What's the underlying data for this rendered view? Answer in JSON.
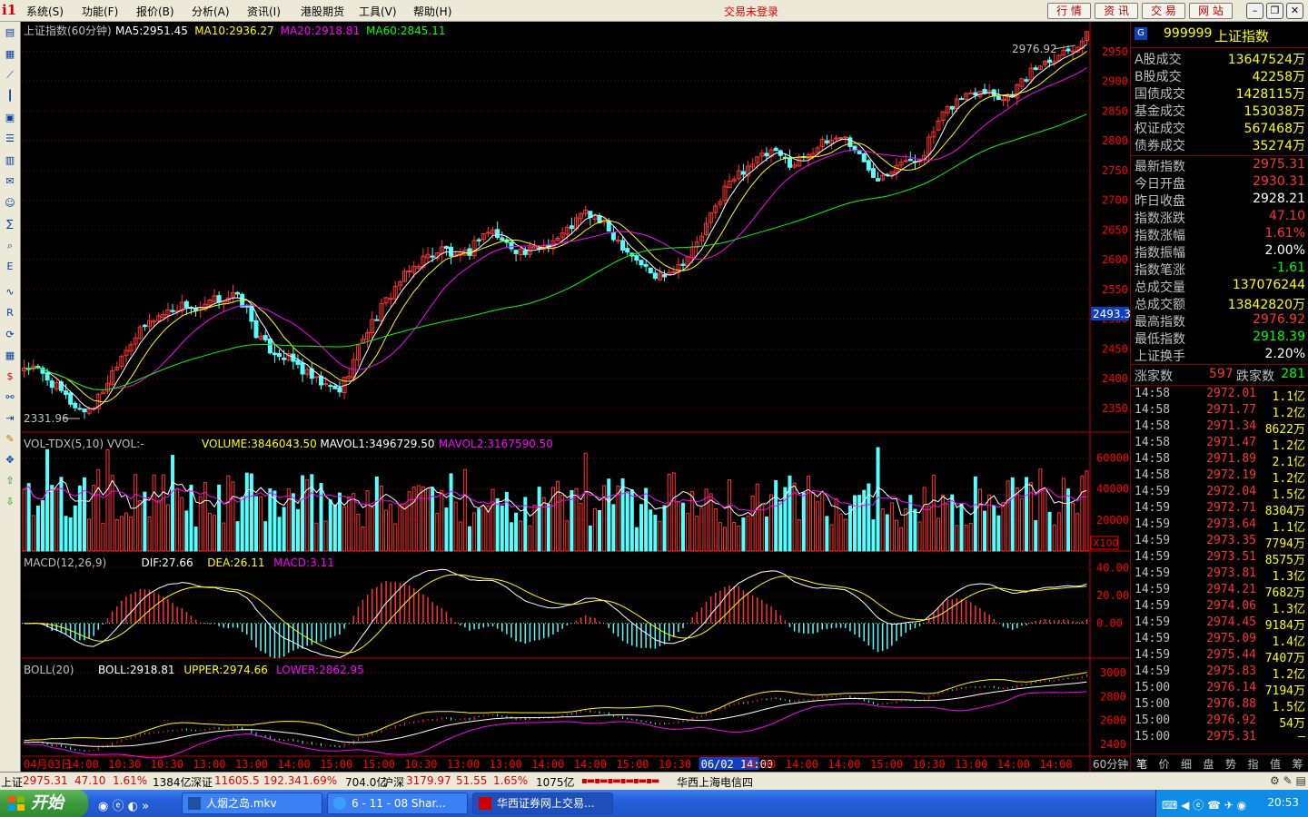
{
  "menu": {
    "items": [
      "系统(S)",
      "功能(F)",
      "报价(B)",
      "分析(A)",
      "资讯(I)",
      "港股期货",
      "工具(V)",
      "帮助(H)"
    ],
    "login_status": "交易未登录",
    "top_buttons": [
      "行 情",
      "资 讯",
      "交 易",
      "网 站"
    ]
  },
  "colors": {
    "up": "#ff3232",
    "down": "#54ffff",
    "ma5": "#ffffff",
    "ma10": "#ffff00",
    "ma20": "#ff00ff",
    "ma60": "#00ff00",
    "axis": "#ff0000",
    "grid": "#800000",
    "text_red": "#ff3232",
    "text_green": "#00ff00",
    "text_yellow": "#ffff00"
  },
  "chart_data": {
    "type": "candlestick",
    "panes": [
      {
        "name": "main",
        "title": "上证指数(60分钟)",
        "indicators": [
          {
            "label": "MA5:2951.45",
            "color": "#ffffff"
          },
          {
            "label": "MA10:2936.27",
            "color": "#ffff00"
          },
          {
            "label": "MA20:2918.81",
            "color": "#ff00ff"
          },
          {
            "label": "MA60:2845.11",
            "color": "#00ff00"
          }
        ],
        "ylim": [
          2310,
          3000
        ],
        "ticks": [
          2350,
          2400,
          2450,
          2500,
          2550,
          2600,
          2650,
          2700,
          2750,
          2800,
          2850,
          2900,
          2950
        ],
        "high_label": "2976.92",
        "low_label": "2331.96",
        "cursor_price": "2493.3",
        "close_path": [
          2420,
          2415,
          2400,
          2380,
          2360,
          2345,
          2355,
          2390,
          2430,
          2460,
          2480,
          2500,
          2510,
          2520,
          2525,
          2510,
          2530,
          2535,
          2540,
          2520,
          2470,
          2450,
          2440,
          2430,
          2410,
          2395,
          2385,
          2380,
          2420,
          2470,
          2500,
          2530,
          2560,
          2580,
          2600,
          2610,
          2620,
          2600,
          2610,
          2640,
          2650,
          2630,
          2620,
          2610,
          2620,
          2630,
          2640,
          2660,
          2680,
          2670,
          2650,
          2630,
          2610,
          2590,
          2570,
          2580,
          2590,
          2610,
          2640,
          2680,
          2720,
          2740,
          2760,
          2770,
          2780,
          2770,
          2760,
          2780,
          2790,
          2800,
          2810,
          2790,
          2760,
          2740,
          2750,
          2770,
          2760,
          2780,
          2820,
          2850,
          2870,
          2880,
          2890,
          2880,
          2870,
          2890,
          2910,
          2930,
          2940,
          2950,
          2960,
          2975
        ]
      },
      {
        "name": "volume",
        "title": "VOL-TDX(5,10) VVOL:-",
        "indicators": [
          {
            "label": "VOLUME:3846043.50",
            "color": "#ffff00"
          },
          {
            "label": "MAVOL1:3496729.50",
            "color": "#ffffff"
          },
          {
            "label": "MAVOL2:3167590.50",
            "color": "#ff00ff"
          }
        ],
        "ylim": [
          0,
          75000
        ],
        "ticks": [
          20000,
          40000,
          60000
        ],
        "unit_label": "X100"
      },
      {
        "name": "macd",
        "title": "MACD(12,26,9)",
        "indicators": [
          {
            "label": "DIF:27.66",
            "color": "#ffffff"
          },
          {
            "label": "DEA:26.11",
            "color": "#ffff00"
          },
          {
            "label": "MACD:3.11",
            "color": "#ff00ff"
          }
        ],
        "ylim": [
          -25,
          50
        ],
        "ticks": [
          0.0,
          20.0,
          40.0
        ]
      },
      {
        "name": "boll",
        "title": "BOLL(20)",
        "indicators": [
          {
            "label": "BOLL:2918.81",
            "color": "#ffffff"
          },
          {
            "label": "UPPER:2974.66",
            "color": "#ffff00"
          },
          {
            "label": "LOWER:2862.95",
            "color": "#ff00ff"
          }
        ],
        "ylim": [
          2300,
          3100
        ],
        "ticks": [
          2400,
          2600,
          2800,
          3000
        ]
      }
    ],
    "x_labels": [
      "04月03日",
      "14:00",
      "10:30",
      "10:30",
      "13:00",
      "13:00",
      "14:00",
      "15:00",
      "15:00",
      "10:30",
      "13:00",
      "13:00",
      "14:00",
      "14:00",
      "15:00",
      "10:30",
      "06/02 14:00",
      "13:00",
      "14:00",
      "14:00",
      "15:00",
      "10:30",
      "13:00",
      "14:00",
      "14:00"
    ],
    "period_label": "60分钟"
  },
  "quote": {
    "badge": "G",
    "code": "999999",
    "name": "上证指数",
    "rows_vol": [
      {
        "label": "A股成交",
        "value": "13647524万",
        "color": "#ffff00"
      },
      {
        "label": "B股成交",
        "value": "42258万",
        "color": "#ffff00"
      },
      {
        "label": "国债成交",
        "value": "1428115万",
        "color": "#ffff00"
      },
      {
        "label": "基金成交",
        "value": "153038万",
        "color": "#ffff00"
      },
      {
        "label": "权证成交",
        "value": "567468万",
        "color": "#ffff00"
      },
      {
        "label": "债券成交",
        "value": "35274万",
        "color": "#ffff00"
      }
    ],
    "rows_idx": [
      {
        "label": "最新指数",
        "value": "2975.31",
        "color": "#ff3232"
      },
      {
        "label": "今日开盘",
        "value": "2930.31",
        "color": "#ff3232"
      },
      {
        "label": "昨日收盘",
        "value": "2928.21",
        "color": "#ffffff"
      },
      {
        "label": "指数涨跌",
        "value": "47.10",
        "color": "#ff3232"
      },
      {
        "label": "指数涨幅",
        "value": "1.61%",
        "color": "#ff3232"
      },
      {
        "label": "指数振幅",
        "value": "2.00%",
        "color": "#ffffff"
      },
      {
        "label": "指数笔涨",
        "value": "-1.61",
        "color": "#00ff00"
      },
      {
        "label": "总成交量",
        "value": "137076244",
        "color": "#ffff00"
      },
      {
        "label": "总成交额",
        "value": "13842820万",
        "color": "#ffff00"
      },
      {
        "label": "最高指数",
        "value": "2976.92",
        "color": "#ff3232"
      },
      {
        "label": "最低指数",
        "value": "2918.39",
        "color": "#00ff00"
      },
      {
        "label": "上证换手",
        "value": "2.20%",
        "color": "#ffffff"
      }
    ],
    "up_label": "涨家数",
    "up_count": "597",
    "down_label": "跌家数",
    "down_count": "281",
    "ticks": [
      {
        "time": "14:58",
        "price": "2972.01",
        "vol": "1.1亿"
      },
      {
        "time": "14:58",
        "price": "2971.77",
        "vol": "1.2亿"
      },
      {
        "time": "14:58",
        "price": "2971.34",
        "vol": "8622万"
      },
      {
        "time": "14:58",
        "price": "2971.47",
        "vol": "1.2亿"
      },
      {
        "time": "14:58",
        "price": "2971.89",
        "vol": "2.1亿"
      },
      {
        "time": "14:58",
        "price": "2972.19",
        "vol": "1.2亿"
      },
      {
        "time": "14:59",
        "price": "2972.04",
        "vol": "1.5亿"
      },
      {
        "time": "14:59",
        "price": "2972.71",
        "vol": "8304万"
      },
      {
        "time": "14:59",
        "price": "2973.64",
        "vol": "1.1亿"
      },
      {
        "time": "14:59",
        "price": "2973.35",
        "vol": "7794万"
      },
      {
        "time": "14:59",
        "price": "2973.51",
        "vol": "8575万"
      },
      {
        "time": "14:59",
        "price": "2973.81",
        "vol": "1.3亿"
      },
      {
        "time": "14:59",
        "price": "2974.21",
        "vol": "7682万"
      },
      {
        "time": "14:59",
        "price": "2974.06",
        "vol": "1.3亿"
      },
      {
        "time": "14:59",
        "price": "2974.45",
        "vol": "9184万"
      },
      {
        "time": "14:59",
        "price": "2975.09",
        "vol": "1.4亿"
      },
      {
        "time": "14:59",
        "price": "2975.44",
        "vol": "7407万"
      },
      {
        "time": "14:59",
        "price": "2975.83",
        "vol": "1.2亿"
      },
      {
        "time": "15:00",
        "price": "2976.14",
        "vol": "7194万"
      },
      {
        "time": "15:00",
        "price": "2976.88",
        "vol": "1.5亿"
      },
      {
        "time": "15:00",
        "price": "2976.92",
        "vol": "54万"
      },
      {
        "time": "15:00",
        "price": "2975.31",
        "vol": "—"
      }
    ],
    "tabs": [
      "笔",
      "价",
      "细",
      "盘",
      "势",
      "指",
      "值",
      "筹"
    ]
  },
  "status": {
    "sh_label": "上证",
    "sh_price": "2975.31",
    "sh_chg": "47.10",
    "sh_pct": "1.61%",
    "sh_amt": "1384亿",
    "sz_label": "深证",
    "sz_price": "11605.5",
    "sz_chg": "192.34",
    "sz_pct": "1.69%",
    "sz_amt": "704.0亿",
    "hs_label": "沪深",
    "hs_price": "3179.97",
    "hs_chg": "51.55",
    "hs_pct": "1.65%",
    "hs_amt": "1075亿",
    "server": "华西上海电信四"
  },
  "taskbar": {
    "start": "开始",
    "items": [
      "人烟之岛.mkv",
      "6 - 11 - 08 Shar...",
      "华西证券网上交易..."
    ],
    "clock": "20:53"
  }
}
